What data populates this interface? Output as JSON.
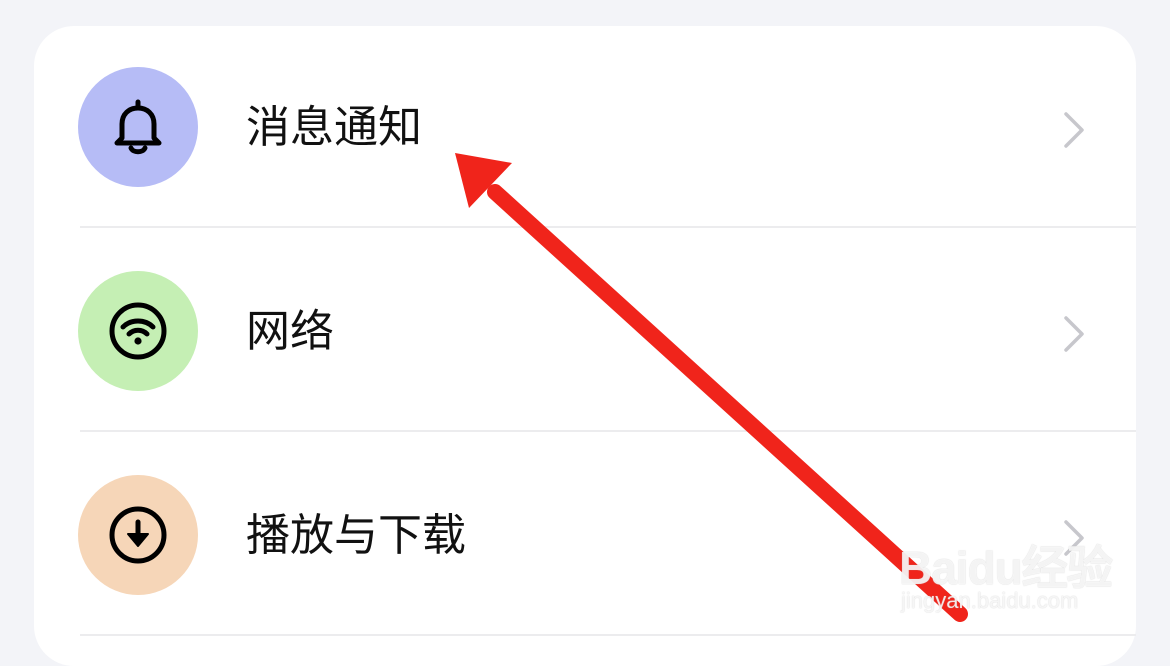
{
  "settings": {
    "items": [
      {
        "label": "消息通知",
        "icon": "bell-icon",
        "icon_bg": "#b6bcf6"
      },
      {
        "label": "网络",
        "icon": "wifi-icon",
        "icon_bg": "#c5efb4"
      },
      {
        "label": "播放与下载",
        "icon": "download-icon",
        "icon_bg": "#f6d6b8"
      }
    ]
  },
  "annotation": {
    "arrow_color": "#f0241b"
  },
  "watermark": {
    "logo": "Baidu经验",
    "url": "jingyan.baidu.com"
  }
}
